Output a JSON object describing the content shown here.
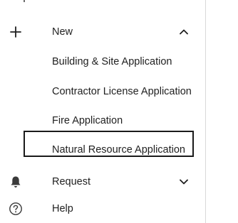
{
  "menu": {
    "new": {
      "label": "New",
      "icon": "plus-icon",
      "expanded": true
    },
    "submenu": [
      {
        "label": "Building & Site Application"
      },
      {
        "label": "Contractor License Application"
      },
      {
        "label": "Fire Application"
      },
      {
        "label": "Natural Resource Application",
        "highlighted": true
      }
    ],
    "request": {
      "label": "Request",
      "icon": "bell-icon",
      "expanded": false
    },
    "help": {
      "label": "Help",
      "icon": "help-circle-icon"
    }
  },
  "colors": {
    "text": "#1f1f1f",
    "icon": "#3a3a3a",
    "highlight_border": "#1a1a1a",
    "divider": "#d9d9d9"
  }
}
